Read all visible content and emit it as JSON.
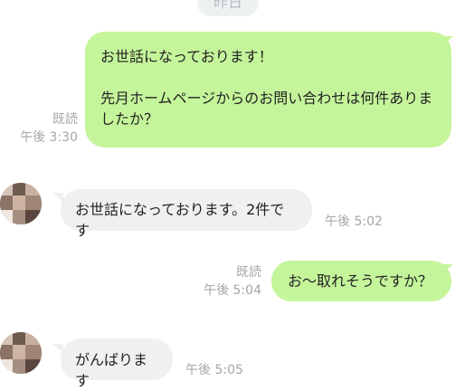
{
  "chat": {
    "date_divider": "昨日",
    "messages": [
      {
        "direction": "sent",
        "text": "お世話になっております！\n\n先月ホームページからのお問い合わせは何件ありましたか？",
        "read": "既読",
        "time": "午後 3:30"
      },
      {
        "direction": "received",
        "text": "お世話になっております。2件です",
        "time": "午後 5:02"
      },
      {
        "direction": "sent",
        "text": "お〜取れそうですか？",
        "read": "既読",
        "time": "午後 5:04"
      },
      {
        "direction": "received",
        "text": "がんばります",
        "time": "午後 5:05"
      }
    ]
  },
  "colors": {
    "sent_bubble": "#c5f59b",
    "received_bubble": "#eef0f2",
    "meta_text": "#a3a7ab",
    "date_pill": "#eef1f2"
  },
  "icons": {
    "avatar": "pixelated-user-avatar"
  }
}
